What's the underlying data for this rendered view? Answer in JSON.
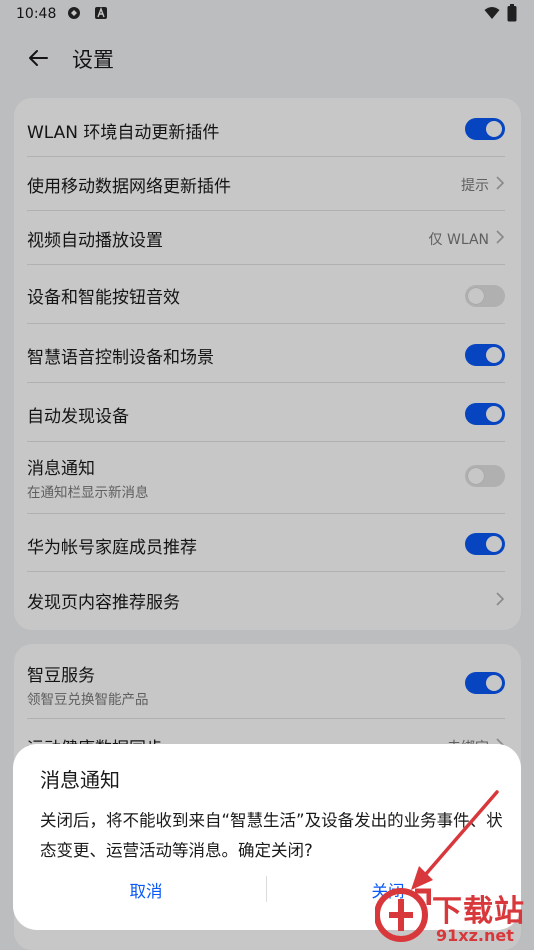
{
  "status_bar": {
    "time": "10:48"
  },
  "header": {
    "title": "设置"
  },
  "settings_card": {
    "rows": [
      {
        "title": "WLAN 环境自动更新插件",
        "toggle": "on"
      },
      {
        "title": "使用移动数据网络更新插件",
        "value": "提示"
      },
      {
        "title": "视频自动播放设置",
        "value": "仅 WLAN"
      },
      {
        "title": "设备和智能按钮音效",
        "toggle": "off"
      },
      {
        "title": "智慧语音控制设备和场景",
        "toggle": "on"
      },
      {
        "title": "自动发现设备",
        "toggle": "on"
      },
      {
        "title": "消息通知",
        "subtitle": "在通知栏显示新消息",
        "toggle": "off"
      },
      {
        "title": "华为帐号家庭成员推荐",
        "toggle": "on"
      },
      {
        "title": "发现页内容推荐服务"
      }
    ]
  },
  "services_card": {
    "rows": [
      {
        "title": "智豆服务",
        "subtitle": "领智豆兑换智能产品",
        "toggle": "on"
      },
      {
        "title": "运动健康数据同步",
        "value": "未绑定"
      }
    ]
  },
  "dialog": {
    "title": "消息通知",
    "body": "关闭后，将不能收到来自“智慧生活”及设备发出的业务事件、状态变更、运营活动等消息。确定关闭?",
    "cancel_label": "取消",
    "confirm_label": "关闭"
  },
  "watermark": {
    "text": "下载站",
    "url": "91xz.net"
  },
  "colors": {
    "accent": "#0a59f7",
    "background": "#f1f3f5",
    "annotation": "#d8383b"
  }
}
